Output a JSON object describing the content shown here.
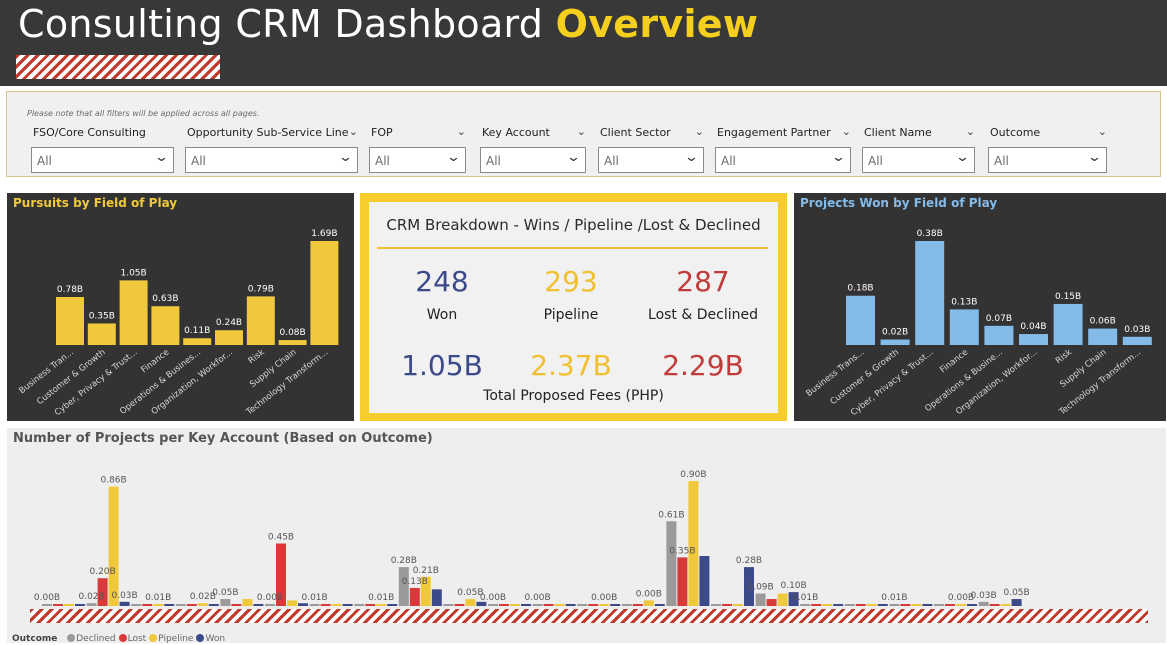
{
  "header": {
    "title_main": "Consulting CRM Dashboard",
    "title_accent": "Overview"
  },
  "colors": {
    "header_bg": "#383838",
    "accent_yellow": "#f5cf1e",
    "won_blue": "#3d4a8a",
    "lost_red": "#c23b3b",
    "declined_gray": "#9a9a9a",
    "light_blue": "#85bbe8"
  },
  "filters": {
    "note": "Please note that all filters will be applied across all pages.",
    "items": [
      {
        "label": "FSO/Core Consulting",
        "value": "All"
      },
      {
        "label": "Opportunity Sub-Service Line",
        "value": "All"
      },
      {
        "label": "FOP",
        "value": "All"
      },
      {
        "label": "Key Account",
        "value": "All"
      },
      {
        "label": "Client Sector",
        "value": "All"
      },
      {
        "label": "Engagement Partner",
        "value": "All"
      },
      {
        "label": "Client Name",
        "value": "All"
      },
      {
        "label": "Outcome",
        "value": "All"
      }
    ]
  },
  "kpi": {
    "heading": "CRM Breakdown - Wins / Pipeline /Lost & Declined",
    "won_count": "248",
    "won_label": "Won",
    "pipeline_count": "293",
    "pipeline_label": "Pipeline",
    "lost_count": "287",
    "lost_label": "Lost & Declined",
    "won_fees": "1.05B",
    "pipeline_fees": "2.37B",
    "lost_fees": "2.29B",
    "fees_label": "Total Proposed Fees (PHP)"
  },
  "chart_data": [
    {
      "type": "bar",
      "title": "Pursuits by Field of Play",
      "categories": [
        "Business Tran...",
        "Customer & Growth",
        "Cyber, Privacy & Trust...",
        "Finance",
        "Operations & Busines...",
        "Organization, Workfor...",
        "Risk",
        "Supply Chain",
        "Technology Transform..."
      ],
      "values": [
        0.78,
        0.35,
        1.05,
        0.63,
        0.11,
        0.24,
        0.79,
        0.08,
        1.69
      ],
      "labels": [
        "0.78B",
        "0.35B",
        "1.05B",
        "0.63B",
        "0.11B",
        "0.24B",
        "0.79B",
        "0.08B",
        "1.69B"
      ],
      "color": "#f0c83c"
    },
    {
      "type": "bar",
      "title": "Projects Won by Field of Play",
      "categories": [
        "Business Trans...",
        "Customer & Growth",
        "Cyber, Privacy & Trust...",
        "Finance",
        "Operations & Busine...",
        "Organization, Workfor...",
        "Risk",
        "Supply Chain",
        "Technology Transform..."
      ],
      "values": [
        0.18,
        0.02,
        0.38,
        0.13,
        0.07,
        0.04,
        0.15,
        0.06,
        0.03
      ],
      "labels": [
        "0.18B",
        "0.02B",
        "0.38B",
        "0.13B",
        "0.07B",
        "0.04B",
        "0.15B",
        "0.06B",
        "0.03B"
      ],
      "color": "#85bbe8"
    },
    {
      "type": "bar",
      "title": "Number of Projects per Key Account (Based on Outcome)",
      "legend_title": "Outcome",
      "legend_position": "bottom-left",
      "series": [
        {
          "name": "Declined",
          "color": "#9a9a9a"
        },
        {
          "name": "Lost",
          "color": "#d83a3a"
        },
        {
          "name": "Pipeline",
          "color": "#f0c83c"
        },
        {
          "name": "Won",
          "color": "#3d4a8a"
        }
      ],
      "groups": [
        {
          "bars": [
            0.0,
            0.0,
            0.0,
            0.0
          ],
          "labels": [
            {
              "series": 0,
              "text": "0.00B"
            }
          ]
        },
        {
          "bars": [
            0.02,
            0.2,
            0.86,
            0.03
          ],
          "labels": [
            {
              "series": 0,
              "text": "0.02B"
            },
            {
              "series": 1,
              "text": "0.20B"
            },
            {
              "series": 2,
              "text": "0.86B"
            },
            {
              "series": 3,
              "text": "0.03B"
            }
          ]
        },
        {
          "bars": [
            0.0,
            0.0,
            0.01,
            0.0
          ],
          "labels": [
            {
              "series": 2,
              "text": "0.01B"
            }
          ]
        },
        {
          "bars": [
            0.0,
            0.0,
            0.02,
            0.0
          ],
          "labels": [
            {
              "series": 2,
              "text": "0.02B"
            }
          ]
        },
        {
          "bars": [
            0.05,
            0.0,
            0.05,
            0.0
          ],
          "labels": [
            {
              "series": 0,
              "text": "0.05B"
            }
          ]
        },
        {
          "bars": [
            0.0,
            0.45,
            0.04,
            0.02
          ],
          "labels": [
            {
              "series": 0,
              "text": "0.00B"
            },
            {
              "series": 1,
              "text": "0.45B"
            }
          ]
        },
        {
          "bars": [
            0.01,
            0.0,
            0.01,
            0.0
          ],
          "labels": [
            {
              "series": 0,
              "text": "0.01B"
            }
          ]
        },
        {
          "bars": [
            0.0,
            0.0,
            0.01,
            0.0
          ],
          "labels": [
            {
              "series": 2,
              "text": "0.01B"
            }
          ]
        },
        {
          "bars": [
            0.28,
            0.13,
            0.21,
            0.12
          ],
          "labels": [
            {
              "series": 0,
              "text": "0.28B"
            },
            {
              "series": 1,
              "text": "0.13B"
            },
            {
              "series": 2,
              "text": "0.21B"
            }
          ]
        },
        {
          "bars": [
            0.0,
            0.0,
            0.05,
            0.03
          ],
          "labels": [
            {
              "series": 2,
              "text": "0.05B"
            }
          ]
        },
        {
          "bars": [
            0.0,
            0.0,
            0.0,
            0.01
          ],
          "labels": [
            {
              "series": 0,
              "text": "0.00B"
            }
          ]
        },
        {
          "bars": [
            0.0,
            0.0,
            0.0,
            0.01
          ],
          "labels": [
            {
              "series": 0,
              "text": "0.00B"
            }
          ]
        },
        {
          "bars": [
            0.0,
            0.0,
            0.0,
            0.01
          ],
          "labels": [
            {
              "series": 2,
              "text": "0.00B"
            }
          ]
        },
        {
          "bars": [
            0.0,
            0.0,
            0.04,
            0.0
          ],
          "labels": [
            {
              "series": 2,
              "text": "0.00B"
            }
          ]
        },
        {
          "bars": [
            0.61,
            0.35,
            0.9,
            0.36
          ],
          "labels": [
            {
              "series": 0,
              "text": "0.61B"
            },
            {
              "series": 1,
              "text": "0.35B"
            },
            {
              "series": 2,
              "text": "0.90B"
            }
          ]
        },
        {
          "bars": [
            0.0,
            0.0,
            0.0,
            0.28
          ],
          "labels": [
            {
              "series": 3,
              "text": "0.28B"
            }
          ]
        },
        {
          "bars": [
            0.09,
            0.05,
            0.09,
            0.1
          ],
          "labels": [
            {
              "series": 0,
              "text": "0.09B"
            },
            {
              "series": 3,
              "text": "0.10B"
            }
          ]
        },
        {
          "bars": [
            0.01,
            0.0,
            0.01,
            0.0
          ],
          "labels": [
            {
              "series": 0,
              "text": "0.01B"
            }
          ]
        },
        {
          "bars": [
            0.0,
            0.0,
            0.0,
            0.0
          ],
          "labels": []
        },
        {
          "bars": [
            0.0,
            0.0,
            0.01,
            0.0
          ],
          "labels": [
            {
              "series": 0,
              "text": "0.01B"
            }
          ]
        },
        {
          "bars": [
            0.0,
            0.0,
            0.0,
            0.0
          ],
          "labels": [
            {
              "series": 2,
              "text": "0.00B"
            }
          ]
        },
        {
          "bars": [
            0.03,
            0.0,
            0.0,
            0.05
          ],
          "labels": [
            {
              "series": 0,
              "text": "0.03B"
            },
            {
              "series": 3,
              "text": "0.05B"
            }
          ]
        }
      ]
    }
  ]
}
